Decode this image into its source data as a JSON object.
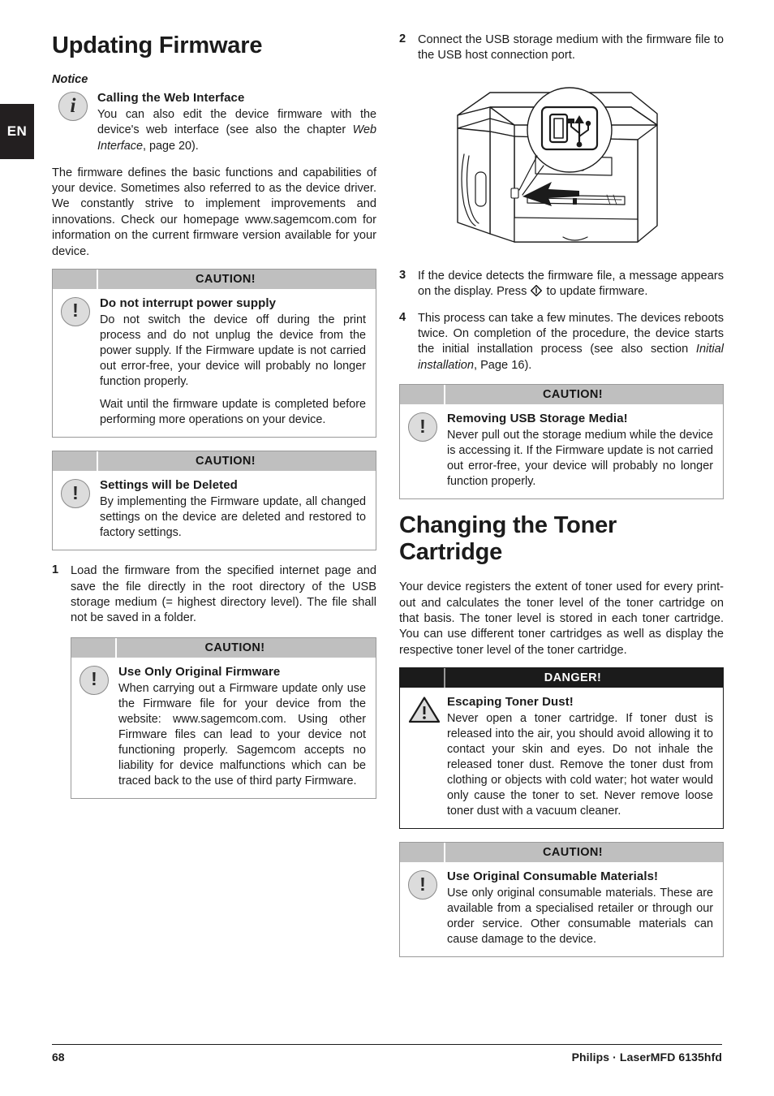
{
  "language_tab": "EN",
  "left_column": {
    "title": "Updating Firmware",
    "notice_label": "Notice",
    "notice": {
      "icon": "info-circle-icon",
      "title": "Calling the Web Interface",
      "body_before": "You can also edit the device firmware with the device's web interface (see also the chapter ",
      "body_italic": "Web Interface",
      "body_after": ", page  20)."
    },
    "intro_paragraph": "The firmware defines the basic functions and capabilities of your device. Sometimes also referred to as the device driver. We constantly strive to implement improvements and innovations. Check our homepage www.sagemcom.com for information on the current firmware version available for your device.",
    "caution_power": {
      "header": "CAUTION!",
      "icon": "exclamation-circle-icon",
      "title": "Do not interrupt power supply",
      "paragraph_1": "Do not switch the device off during the print process and do not unplug the device from the power supply. If the Firmware update is not carried out error-free, your device will probably no longer function properly.",
      "paragraph_2": "Wait until the firmware update is completed before performing more operations on your device."
    },
    "caution_settings": {
      "header": "CAUTION!",
      "icon": "exclamation-circle-icon",
      "title": "Settings will be Deleted",
      "paragraph_1": "By implementing the Firmware update, all changed settings on the device are deleted and restored to factory settings."
    },
    "step_1": {
      "number": "1",
      "text": "Load the firmware from the specified internet page and save the file directly in the root directory of the USB storage medium (= highest directory level). The file shall not be saved in a folder."
    },
    "caution_firmware": {
      "header": "CAUTION!",
      "icon": "exclamation-circle-icon",
      "title": "Use Only Original Firmware",
      "paragraph_1": "When carrying out a Firmware update only use the Firmware file for your device from the website: www.sagemcom.com. Using other Firmware files can lead to your device not functioning properly. Sagemcom accepts no liability for device malfunctions which can be traced back to the use of third party Firmware."
    }
  },
  "right_column": {
    "step_2": {
      "number": "2",
      "text": "Connect the USB storage medium with the firmware file to the USB host connection port."
    },
    "figure": {
      "name": "printer-usb-port-illustration",
      "callout_icon": "usb-port-icon"
    },
    "step_3": {
      "number": "3",
      "text_before": "If the device detects the firmware file, a message appears on the display. Press ",
      "key_icon": "start-key-diamond-icon",
      "text_after": " to update firmware."
    },
    "step_4": {
      "number": "4",
      "text_before": "This process can take a few minutes. The devices reboots twice. On completion of the procedure, the device starts the initial installation process (see also section ",
      "text_italic": "Initial installation",
      "text_after": ", Page  16)."
    },
    "caution_usb": {
      "header": "CAUTION!",
      "icon": "exclamation-circle-icon",
      "title": "Removing USB Storage Media!",
      "paragraph_1": "Never pull out the storage medium while the device is accessing it. If the Firmware update is not carried out error-free, your device will probably no longer function properly."
    },
    "title": "Changing the Toner Cartridge",
    "toner_paragraph": "Your device registers the extent of toner used for every print-out and calculates the toner level of the toner cartridge on that basis. The toner level is stored in each toner cartridge. You can use different toner cartridges as well as display the respective toner level of the toner cartridge.",
    "danger_toner": {
      "header": "DANGER!",
      "icon": "warning-triangle-icon",
      "title": "Escaping Toner Dust!",
      "paragraph_1": "Never open a toner cartridge. If toner dust is released into the air, you should avoid allowing it to contact your skin and eyes. Do not inhale the released toner dust. Remove the toner dust from clothing or objects with cold water; hot water would only cause the toner to set. Never remove loose toner dust with a vacuum cleaner."
    },
    "caution_consumables": {
      "header": "CAUTION!",
      "icon": "exclamation-circle-icon",
      "title": "Use Original Consumable Materials!",
      "paragraph_1": "Use only original consumable materials. These are available from a specialised retailer or through our order service. Other consumable materials can cause damage to the device."
    }
  },
  "footer": {
    "page_number": "68",
    "brand": "Philips · LaserMFD 6135hfd"
  },
  "colors": {
    "caution_header_bg": "#bfbfbf",
    "danger_header_bg": "#1b1b1b",
    "icon_fill": "#dcdcdc",
    "text": "#1b1b1b"
  }
}
